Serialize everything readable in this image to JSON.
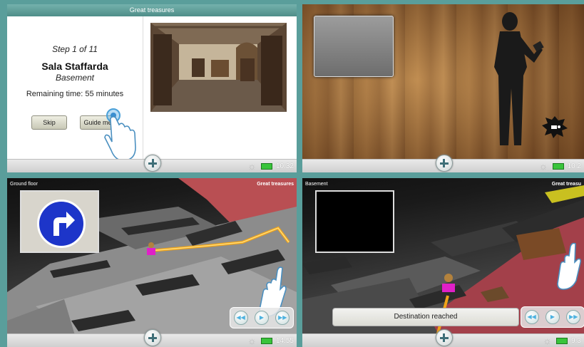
{
  "panel1": {
    "title": "Great treasures",
    "step": "Step 1 of 11",
    "room": "Sala Staffarda",
    "floor": "Basement",
    "remaining": "Remaining time: 55 minutes",
    "skip_label": "Skip",
    "guide_label": "Guide me",
    "clock": "10:32"
  },
  "panel2": {
    "clock": "10:2"
  },
  "panel3": {
    "floor_label": "Ground floor",
    "title": "Great treasures",
    "clock": "14:55"
  },
  "panel4": {
    "floor_label": "Basement",
    "title": "Great treasu",
    "destination": "Destination reached",
    "clock": "9:3"
  },
  "colors": {
    "frame": "#5a9e9b",
    "titlebar": "#5f9f9a",
    "route": "#f0a418",
    "marker": "#e020c8"
  }
}
